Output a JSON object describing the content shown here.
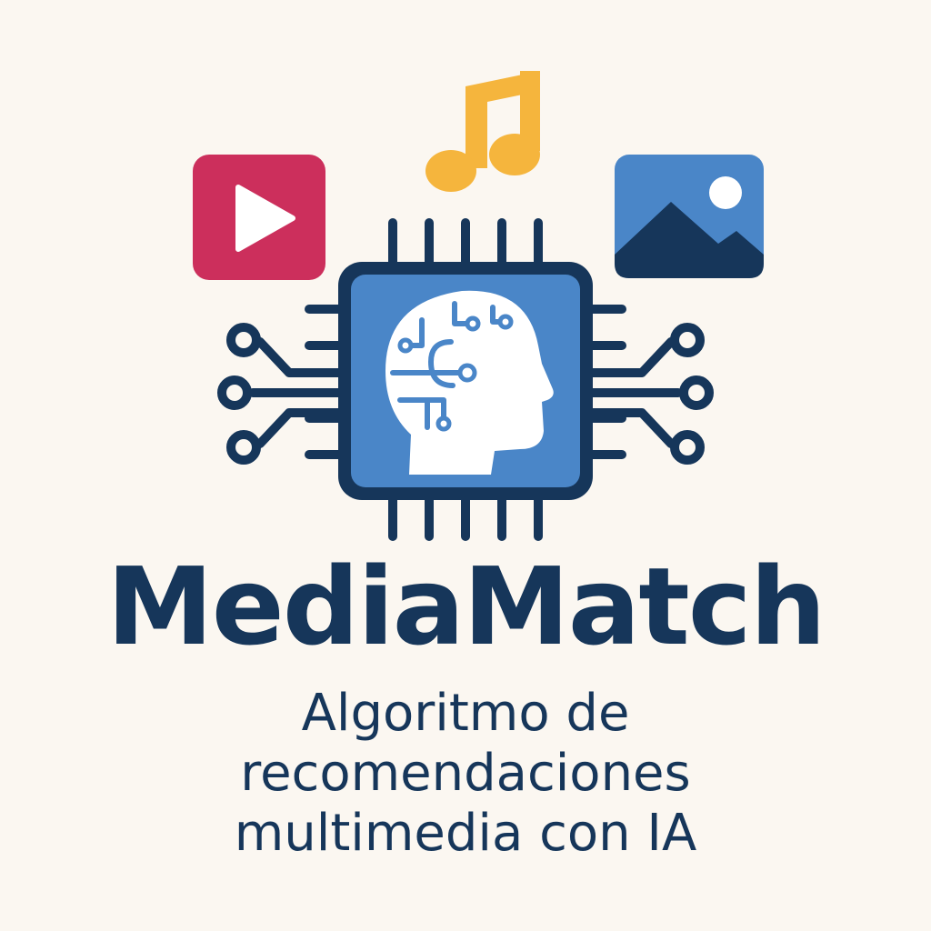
{
  "brand": {
    "title": "MediaMatch",
    "tagline_lines": [
      "Algoritmo de",
      "recomendaciones",
      "multimedia con IA"
    ]
  },
  "icons": {
    "video": "play-button-icon",
    "music": "music-note-icon",
    "image": "image-landscape-icon",
    "chip": "ai-chip-icon",
    "head": "brain-head-icon"
  },
  "colors": {
    "background": "#FBF7F1",
    "navy": "#16365A",
    "chip_blue": "#4A86C8",
    "video_red": "#CC2F5C",
    "music_yellow": "#F5B53D",
    "image_blue": "#4A86C8",
    "brain_circuit": "#4A86C8"
  }
}
